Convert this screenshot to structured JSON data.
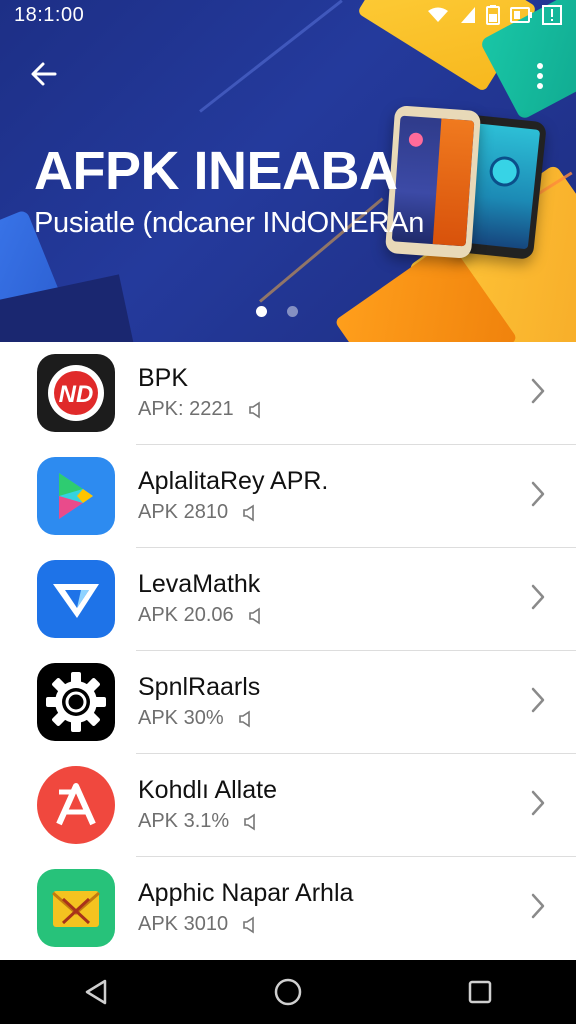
{
  "status_bar": {
    "time": "18:1:00"
  },
  "hero": {
    "title": "AFPK INEABA",
    "subtitle": "Pusiatle (ndcaner INdONERAn",
    "carousel": {
      "total": 2,
      "active": 1
    },
    "colors": {
      "background": "#1f3190",
      "accent_yellow": "#ffc83a",
      "accent_orange": "#f58a12",
      "accent_teal": "#19c6a6"
    }
  },
  "apps": [
    {
      "name": "BPK",
      "meta": "APK: 2221",
      "meta_icon": "sound-icon",
      "icon": "nd-logo-icon",
      "icon_bg": "#1c1c1c"
    },
    {
      "name": "AplalitaRey APR.",
      "meta": "APK 2810",
      "meta_icon": "sound-icon",
      "icon": "play-store-icon",
      "icon_bg": "#2d8bf0"
    },
    {
      "name": "LevaMathk",
      "meta": "APK 20.06",
      "meta_icon": "sound-icon",
      "icon": "paper-plane-icon",
      "icon_bg": "#1e73e8"
    },
    {
      "name": "SpnlRaarls",
      "meta": "APK 30%",
      "meta_icon": "sound-icon",
      "icon": "gear-icon",
      "icon_bg": "#000000"
    },
    {
      "name": "Kohdlı Allate",
      "meta": "APK 3.1%",
      "meta_icon": "sound-icon",
      "icon": "letter-a-icon",
      "icon_bg": "#f0483e"
    },
    {
      "name": "Apphic Napar Arhla",
      "meta": "APK 3010",
      "meta_icon": "sound-icon",
      "icon": "envelope-icon",
      "icon_bg": "#27c27a"
    }
  ],
  "nav_bar": {
    "back_icon": "back-triangle-icon",
    "home_icon": "home-circle-icon",
    "recents_icon": "recents-square-icon"
  }
}
